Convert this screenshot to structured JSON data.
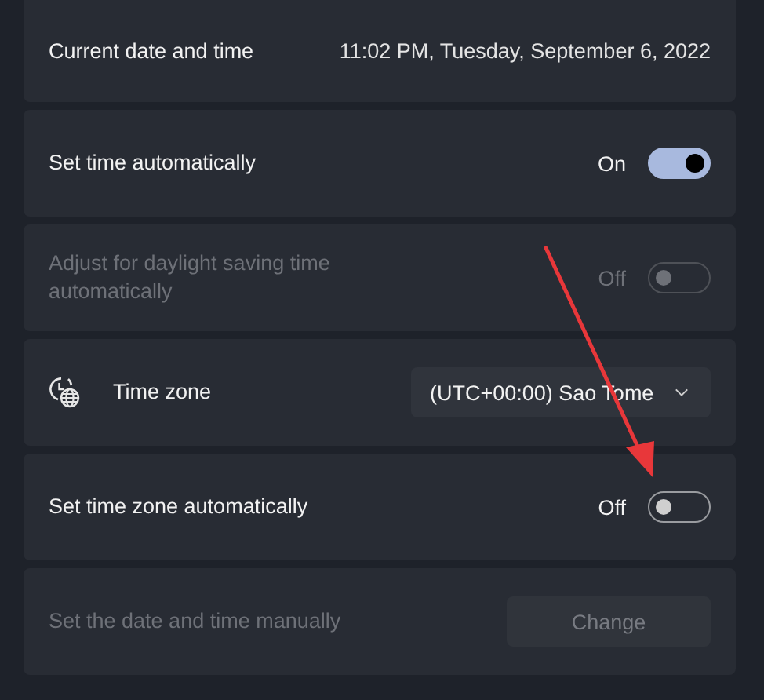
{
  "settings": [
    {
      "kind": "value",
      "label": "Current date and time",
      "value": "11:02 PM, Tuesday, September 6, 2022"
    },
    {
      "kind": "toggle",
      "label": "Set time automatically",
      "state_text": "On",
      "on": true,
      "disabled": false
    },
    {
      "kind": "toggle",
      "label": "Adjust for daylight saving time automatically",
      "state_text": "Off",
      "on": false,
      "disabled": true
    },
    {
      "kind": "dropdown",
      "label": "Time zone",
      "value": "(UTC+00:00) Sao Tome"
    },
    {
      "kind": "toggle",
      "label": "Set time zone automatically",
      "state_text": "Off",
      "on": false,
      "disabled": false
    },
    {
      "kind": "button",
      "label": "Set the date and time manually",
      "button": "Change",
      "disabled": true
    }
  ],
  "annotations": [
    {
      "kind": "arrow"
    }
  ]
}
